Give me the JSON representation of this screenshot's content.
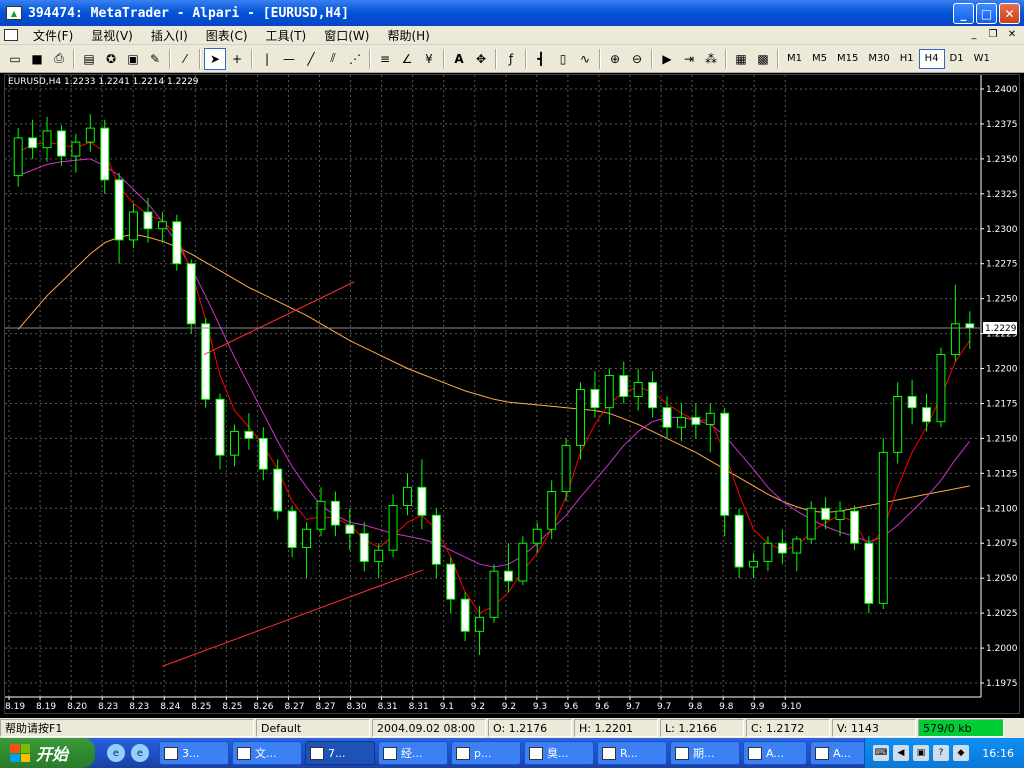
{
  "window": {
    "title": "394474: MetaTrader - Alpari - [EURUSD,H4]"
  },
  "menu": [
    {
      "label": "文件(F)"
    },
    {
      "label": "显视(V)"
    },
    {
      "label": "插入(I)"
    },
    {
      "label": "图表(C)"
    },
    {
      "label": "工具(T)"
    },
    {
      "label": "窗口(W)"
    },
    {
      "label": "帮助(H)"
    }
  ],
  "toolbar": {
    "timeframes": [
      "M1",
      "M5",
      "M15",
      "M30",
      "H1",
      "H4",
      "D1",
      "W1"
    ],
    "selected_timeframe": "H4"
  },
  "chart_data": {
    "type": "candlestick",
    "symbol_label": "EURUSD,H4  1.2233 1.2241 1.2214 1.2229",
    "ylim": [
      1.1965,
      1.241
    ],
    "y_ticks": [
      "1.2400",
      "1.2375",
      "1.2350",
      "1.2325",
      "1.2300",
      "1.2275",
      "1.2250",
      "1.2225",
      "1.2200",
      "1.2175",
      "1.2150",
      "1.2125",
      "1.2100",
      "1.2075",
      "1.2050",
      "1.2025",
      "1.2000",
      "1.1975"
    ],
    "y_tick_values": [
      1.24,
      1.2375,
      1.235,
      1.2325,
      1.23,
      1.2275,
      1.225,
      1.2225,
      1.22,
      1.2175,
      1.215,
      1.2125,
      1.21,
      1.2075,
      1.205,
      1.2025,
      1.2,
      1.1975
    ],
    "x_ticks": [
      "8.19",
      "8.19",
      "8.20",
      "8.23",
      "8.23",
      "8.24",
      "8.25",
      "8.25",
      "8.26",
      "8.27",
      "8.27",
      "8.30",
      "8.31",
      "8.31",
      "9.1",
      "9.2",
      "9.2",
      "9.3",
      "9.6",
      "9.6",
      "9.7",
      "9.7",
      "9.8",
      "9.8",
      "9.9",
      "9.10"
    ],
    "current_price": "1.2229",
    "grid": true,
    "colors": {
      "bull": "#00ff00",
      "bear": "#ffffff",
      "wick": "#00ff00",
      "ma_fast": "#ff0000",
      "ma_mid": "#cc33cc",
      "ma_slow": "#ffaa44",
      "trendline": "#ff3030",
      "grid": "#5a5a5a",
      "text": "#ffffff"
    },
    "ohlc": [
      [
        1.2338,
        1.2372,
        1.233,
        1.2365
      ],
      [
        1.2365,
        1.2378,
        1.235,
        1.2358
      ],
      [
        1.2358,
        1.238,
        1.2348,
        1.237
      ],
      [
        1.237,
        1.2374,
        1.2345,
        1.2352
      ],
      [
        1.2352,
        1.2368,
        1.234,
        1.2362
      ],
      [
        1.2362,
        1.2382,
        1.2355,
        1.2372
      ],
      [
        1.2372,
        1.2378,
        1.2325,
        1.2335
      ],
      [
        1.2335,
        1.234,
        1.2275,
        1.2292
      ],
      [
        1.2292,
        1.2318,
        1.2286,
        1.2312
      ],
      [
        1.2312,
        1.2322,
        1.229,
        1.23
      ],
      [
        1.23,
        1.2312,
        1.229,
        1.2305
      ],
      [
        1.2305,
        1.231,
        1.227,
        1.2275
      ],
      [
        1.2275,
        1.2278,
        1.2225,
        1.2232
      ],
      [
        1.2232,
        1.2236,
        1.2172,
        1.2178
      ],
      [
        1.2178,
        1.2182,
        1.2128,
        1.2138
      ],
      [
        1.2138,
        1.216,
        1.213,
        1.2155
      ],
      [
        1.2155,
        1.2168,
        1.2142,
        1.215
      ],
      [
        1.215,
        1.2158,
        1.212,
        1.2128
      ],
      [
        1.2128,
        1.2135,
        1.2092,
        1.2098
      ],
      [
        1.2098,
        1.2102,
        1.2065,
        1.2072
      ],
      [
        1.2072,
        1.209,
        1.205,
        1.2085
      ],
      [
        1.2085,
        1.2115,
        1.208,
        1.2105
      ],
      [
        1.2105,
        1.2112,
        1.208,
        1.2088
      ],
      [
        1.2088,
        1.21,
        1.207,
        1.2082
      ],
      [
        1.2082,
        1.209,
        1.2055,
        1.2062
      ],
      [
        1.2062,
        1.2075,
        1.205,
        1.207
      ],
      [
        1.207,
        1.211,
        1.2065,
        1.2102
      ],
      [
        1.2102,
        1.2125,
        1.2095,
        1.2115
      ],
      [
        1.2115,
        1.2135,
        1.2085,
        1.2095
      ],
      [
        1.2095,
        1.21,
        1.205,
        1.206
      ],
      [
        1.206,
        1.2065,
        1.2025,
        1.2035
      ],
      [
        1.2035,
        1.204,
        1.2005,
        1.2012
      ],
      [
        1.2012,
        1.203,
        1.1995,
        1.2022
      ],
      [
        1.2022,
        1.206,
        1.2018,
        1.2055
      ],
      [
        1.2055,
        1.2075,
        1.204,
        1.2048
      ],
      [
        1.2048,
        1.208,
        1.2045,
        1.2075
      ],
      [
        1.2075,
        1.209,
        1.2068,
        1.2085
      ],
      [
        1.2085,
        1.212,
        1.2078,
        1.2112
      ],
      [
        1.2112,
        1.215,
        1.2105,
        1.2145
      ],
      [
        1.2145,
        1.219,
        1.2135,
        1.2185
      ],
      [
        1.2185,
        1.2198,
        1.2165,
        1.2172
      ],
      [
        1.2172,
        1.22,
        1.216,
        1.2195
      ],
      [
        1.2195,
        1.2205,
        1.2175,
        1.218
      ],
      [
        1.218,
        1.22,
        1.217,
        1.219
      ],
      [
        1.219,
        1.2198,
        1.2165,
        1.2172
      ],
      [
        1.2172,
        1.218,
        1.215,
        1.2158
      ],
      [
        1.2158,
        1.2175,
        1.2148,
        1.2165
      ],
      [
        1.2165,
        1.2175,
        1.215,
        1.216
      ],
      [
        1.216,
        1.2175,
        1.214,
        1.2168
      ],
      [
        1.2168,
        1.2172,
        1.208,
        1.2095
      ],
      [
        1.2095,
        1.21,
        1.205,
        1.2058
      ],
      [
        1.2058,
        1.2068,
        1.205,
        1.2062
      ],
      [
        1.2062,
        1.208,
        1.2055,
        1.2075
      ],
      [
        1.2075,
        1.2085,
        1.206,
        1.2068
      ],
      [
        1.2068,
        1.208,
        1.2055,
        1.2078
      ],
      [
        1.2078,
        1.2105,
        1.2075,
        1.21
      ],
      [
        1.21,
        1.2108,
        1.2085,
        1.2092
      ],
      [
        1.2092,
        1.2105,
        1.208,
        1.2098
      ],
      [
        1.2098,
        1.2102,
        1.207,
        1.2075
      ],
      [
        1.2075,
        1.208,
        1.2025,
        1.2032
      ],
      [
        1.2032,
        1.215,
        1.2028,
        1.214
      ],
      [
        1.214,
        1.219,
        1.2132,
        1.218
      ],
      [
        1.218,
        1.2192,
        1.216,
        1.2172
      ],
      [
        1.2172,
        1.2182,
        1.2155,
        1.2162
      ],
      [
        1.2162,
        1.2215,
        1.2158,
        1.221
      ],
      [
        1.221,
        1.226,
        1.2205,
        1.2232
      ],
      [
        1.2232,
        1.2241,
        1.2214,
        1.2229
      ]
    ],
    "ma_fast": [
      1.2355,
      1.236,
      1.2362,
      1.236,
      1.2358,
      1.2362,
      1.2355,
      1.233,
      1.2318,
      1.231,
      1.2306,
      1.2295,
      1.227,
      1.2235,
      1.2195,
      1.217,
      1.2158,
      1.2145,
      1.2128,
      1.2105,
      1.2092,
      1.2094,
      1.2093,
      1.2088,
      1.2078,
      1.2072,
      1.208,
      1.209,
      1.2095,
      1.2085,
      1.2065,
      1.204,
      1.2025,
      1.203,
      1.204,
      1.2055,
      1.2068,
      1.2085,
      1.2108,
      1.214,
      1.216,
      1.2175,
      1.2183,
      1.2187,
      1.2183,
      1.2175,
      1.2168,
      1.2163,
      1.2163,
      1.214,
      1.211,
      1.2085,
      1.2075,
      1.207,
      1.2073,
      1.2083,
      1.209,
      1.2095,
      1.209,
      1.2072,
      1.2085,
      1.2115,
      1.214,
      1.2158,
      1.218,
      1.2205,
      1.222
    ],
    "ma_mid": [
      1.2338,
      1.2342,
      1.2346,
      1.2348,
      1.2349,
      1.235,
      1.2345,
      1.2338,
      1.2328,
      1.2318,
      1.2305,
      1.229,
      1.2272,
      1.2252,
      1.223,
      1.2208,
      1.2188,
      1.2168,
      1.2148,
      1.213,
      1.2115,
      1.2102,
      1.2095,
      1.209,
      1.2088,
      1.2085,
      1.2082,
      1.208,
      1.2078,
      1.2075,
      1.207,
      1.2065,
      1.206,
      1.2058,
      1.206,
      1.2066,
      1.2075,
      1.2085,
      1.2095,
      1.2108,
      1.212,
      1.2132,
      1.2145,
      1.2155,
      1.2162,
      1.2165,
      1.2165,
      1.2163,
      1.216,
      1.2152,
      1.214,
      1.2128,
      1.2115,
      1.2105,
      1.2098,
      1.2092,
      1.2087,
      1.2083,
      1.208,
      1.2076,
      1.208,
      1.2088,
      1.2098,
      1.2108,
      1.212,
      1.2135,
      1.2148
    ],
    "ma_slow": [
      1.2228,
      1.224,
      1.2252,
      1.2262,
      1.2272,
      1.2282,
      1.229,
      1.2294,
      1.2296,
      1.2294,
      1.2291,
      1.2287,
      1.2282,
      1.2276,
      1.227,
      1.2264,
      1.2258,
      1.2253,
      1.2248,
      1.2243,
      1.2238,
      1.2232,
      1.2226,
      1.222,
      1.2215,
      1.221,
      1.2205,
      1.22,
      1.2196,
      1.2192,
      1.2188,
      1.2184,
      1.2181,
      1.2178,
      1.2176,
      1.2175,
      1.2174,
      1.2173,
      1.2172,
      1.2171,
      1.217,
      1.2168,
      1.2164,
      1.216,
      1.2155,
      1.215,
      1.2145,
      1.214,
      1.2134,
      1.2128,
      1.2122,
      1.2116,
      1.211,
      1.2105,
      1.2101,
      1.2098,
      1.2097,
      1.2098,
      1.21,
      1.2102,
      1.2104,
      1.2106,
      1.2108,
      1.211,
      1.2112,
      1.2114,
      1.2116
    ],
    "trendlines": [
      {
        "from": [
          12.9,
          1.221
        ],
        "to": [
          23.3,
          1.2262
        ]
      },
      {
        "from": [
          10.0,
          1.1987
        ],
        "to": [
          28.1,
          1.2056
        ]
      }
    ]
  },
  "status": {
    "help": "帮助请按F1",
    "profile": "Default",
    "datetime": "2004.09.02 08:00",
    "open": "O: 1.2176",
    "high": "H: 1.2201",
    "low": "L: 1.2166",
    "close": "C: 1.2172",
    "volume": "V: 1143",
    "traffic": "579/0 kb"
  },
  "taskbar": {
    "start": "开始",
    "tasks": [
      {
        "label": "3..."
      },
      {
        "label": "文..."
      },
      {
        "label": "7..."
      },
      {
        "label": "经..."
      },
      {
        "label": "p..."
      },
      {
        "label": "臭..."
      },
      {
        "label": "R..."
      },
      {
        "label": "期..."
      },
      {
        "label": "A..."
      },
      {
        "label": "A..."
      }
    ],
    "clock": "16:16"
  }
}
